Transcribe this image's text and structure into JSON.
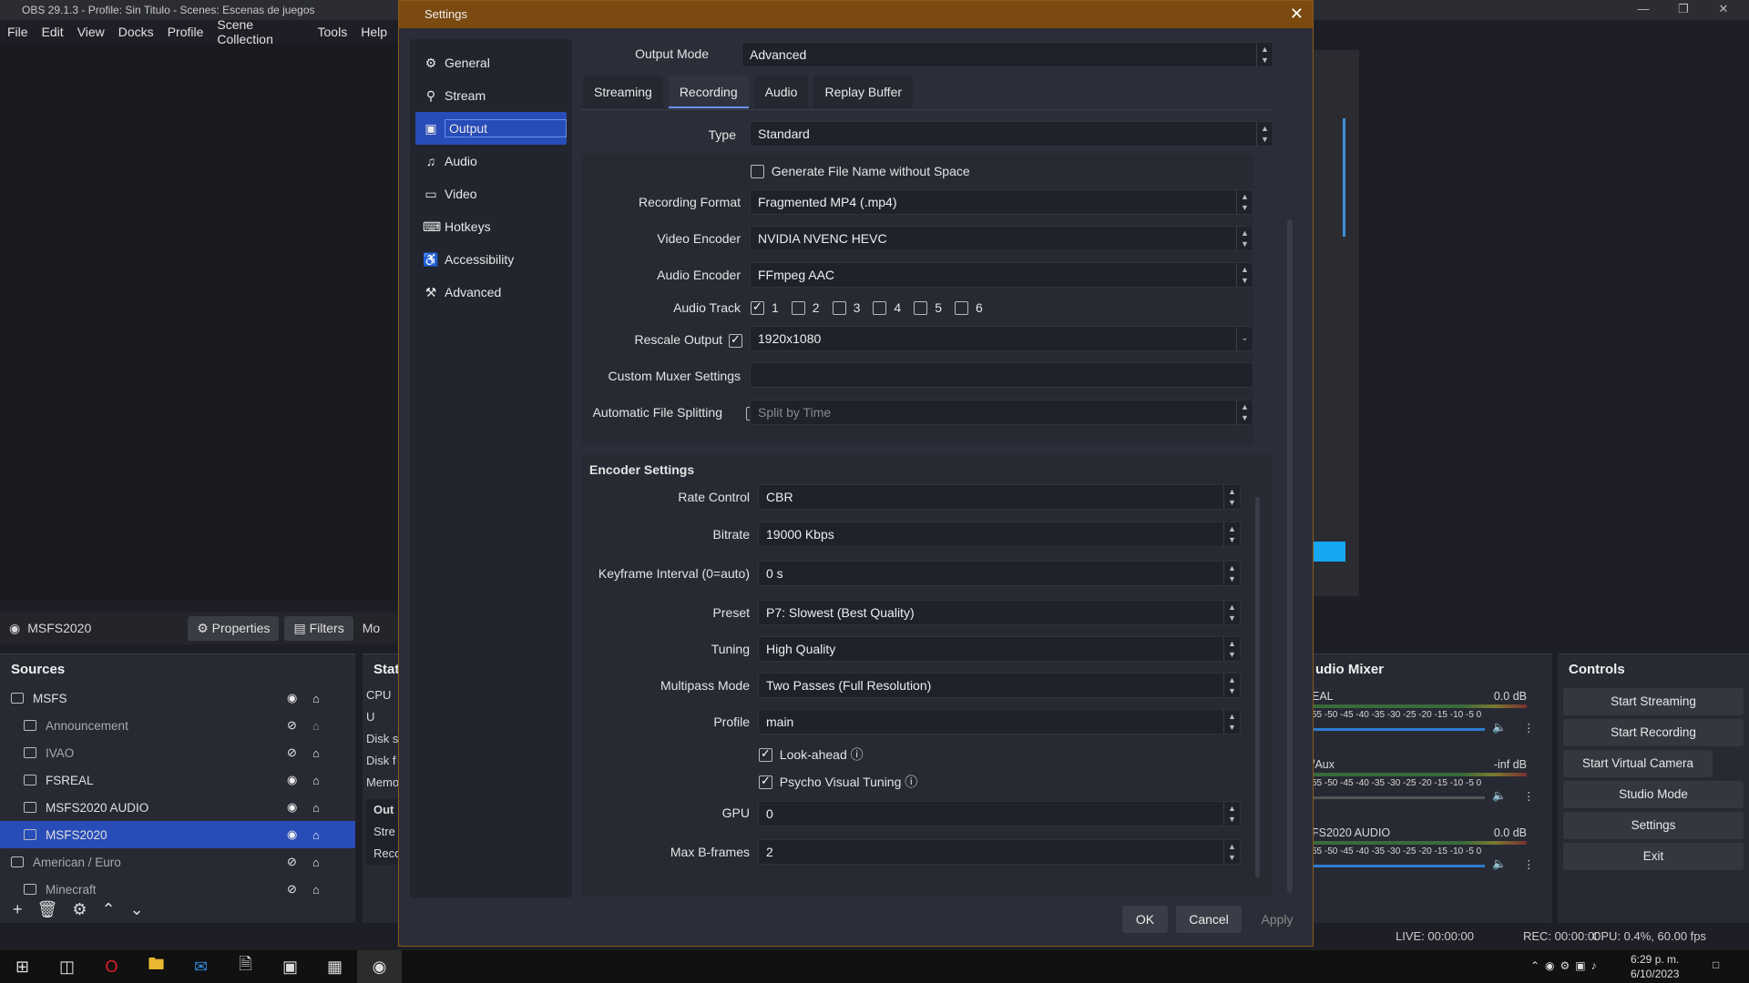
{
  "app": {
    "title": "OBS 29.1.3 - Profile: Sin Titulo - Scenes: Escenas de juegos",
    "menu": [
      "File",
      "Edit",
      "View",
      "Docks",
      "Profile",
      "Scene Collection",
      "Tools",
      "Help"
    ],
    "source_bar": {
      "name": "MSFS2020",
      "properties": "Properties",
      "filters": "Filters",
      "more": "Mo"
    }
  },
  "sources": {
    "title": "Sources",
    "items": [
      {
        "label": "MSFS",
        "visible": true,
        "locked": true
      },
      {
        "label": "Announcement",
        "visible": false,
        "locked": false
      },
      {
        "label": "IVAO",
        "visible": false,
        "locked": true
      },
      {
        "label": "FSREAL",
        "visible": true,
        "locked": true
      },
      {
        "label": "MSFS2020 AUDIO",
        "visible": true,
        "locked": true
      },
      {
        "label": "MSFS2020",
        "visible": true,
        "locked": true,
        "selected": true
      },
      {
        "label": "American / Euro",
        "visible": false,
        "locked": true
      },
      {
        "label": "Minecraft",
        "visible": false,
        "locked": true
      }
    ]
  },
  "stats": {
    "title": "Stats",
    "lines": [
      "CPU U",
      "Disk s",
      "Disk f",
      "Memo"
    ],
    "output_box": [
      "Out",
      "Stre",
      "Reco"
    ]
  },
  "mixer": {
    "title": "udio Mixer",
    "channels": [
      {
        "name": "EAL",
        "db": "0.0 dB",
        "muted": false
      },
      {
        "name": "/Aux",
        "db": "-inf dB",
        "muted": true
      },
      {
        "name": "FS2020 AUDIO",
        "db": "0.0 dB",
        "muted": false
      }
    ],
    "scale": "55 -50 -45 -40 -35 -30 -25 -20 -15 -10 -5 0"
  },
  "controls": {
    "title": "Controls",
    "buttons": [
      "Start Streaming",
      "Start Recording",
      "Start Virtual Camera",
      "Studio Mode",
      "Settings",
      "Exit"
    ]
  },
  "status": {
    "live": "LIVE: 00:00:00",
    "rec": "REC: 00:00:00",
    "cpu": "CPU: 0.4%, 60.00 fps"
  },
  "tray": {
    "time": "6:29 p. m.",
    "date": "6/10/2023"
  },
  "settings": {
    "title": "Settings",
    "nav": [
      {
        "label": "General",
        "icon": "gear-icon"
      },
      {
        "label": "Stream",
        "icon": "antenna-icon"
      },
      {
        "label": "Output",
        "icon": "monitor-out-icon",
        "selected": true
      },
      {
        "label": "Audio",
        "icon": "speaker-icon"
      },
      {
        "label": "Video",
        "icon": "display-icon"
      },
      {
        "label": "Hotkeys",
        "icon": "keyboard-icon"
      },
      {
        "label": "Accessibility",
        "icon": "accessibility-icon"
      },
      {
        "label": "Advanced",
        "icon": "tools-icon"
      }
    ],
    "output_mode_label": "Output Mode",
    "output_mode": "Advanced",
    "tabs": [
      "Streaming",
      "Recording",
      "Audio",
      "Replay Buffer"
    ],
    "active_tab": "Recording",
    "type_label": "Type",
    "type": "Standard",
    "gen_filename": "Generate File Name without Space",
    "rec_format_label": "Recording Format",
    "rec_format": "Fragmented MP4 (.mp4)",
    "video_encoder_label": "Video Encoder",
    "video_encoder": "NVIDIA NVENC HEVC",
    "audio_encoder_label": "Audio Encoder",
    "audio_encoder": "FFmpeg AAC",
    "audio_track_label": "Audio Track",
    "audio_tracks": [
      {
        "n": "1",
        "checked": true
      },
      {
        "n": "2",
        "checked": false
      },
      {
        "n": "3",
        "checked": false
      },
      {
        "n": "4",
        "checked": false
      },
      {
        "n": "5",
        "checked": false
      },
      {
        "n": "6",
        "checked": false
      }
    ],
    "rescale_label": "Rescale Output",
    "rescale": "1920x1080",
    "muxer_label": "Custom Muxer Settings",
    "muxer": "",
    "split_label": "Automatic File Splitting",
    "split": "Split by Time",
    "encoder_settings": "Encoder Settings",
    "rate_control_label": "Rate Control",
    "rate_control": "CBR",
    "bitrate_label": "Bitrate",
    "bitrate": "19000 Kbps",
    "keyframe_label": "Keyframe Interval (0=auto)",
    "keyframe": "0 s",
    "preset_label": "Preset",
    "preset": "P7: Slowest (Best Quality)",
    "tuning_label": "Tuning",
    "tuning": "High Quality",
    "multipass_label": "Multipass Mode",
    "multipass": "Two Passes (Full Resolution)",
    "profile_label": "Profile",
    "profile": "main",
    "lookahead": "Look-ahead",
    "psycho": "Psycho Visual Tuning",
    "gpu_label": "GPU",
    "gpu": "0",
    "bframes_label": "Max B-frames",
    "bframes": "2",
    "ok": "OK",
    "cancel": "Cancel",
    "apply": "Apply"
  }
}
